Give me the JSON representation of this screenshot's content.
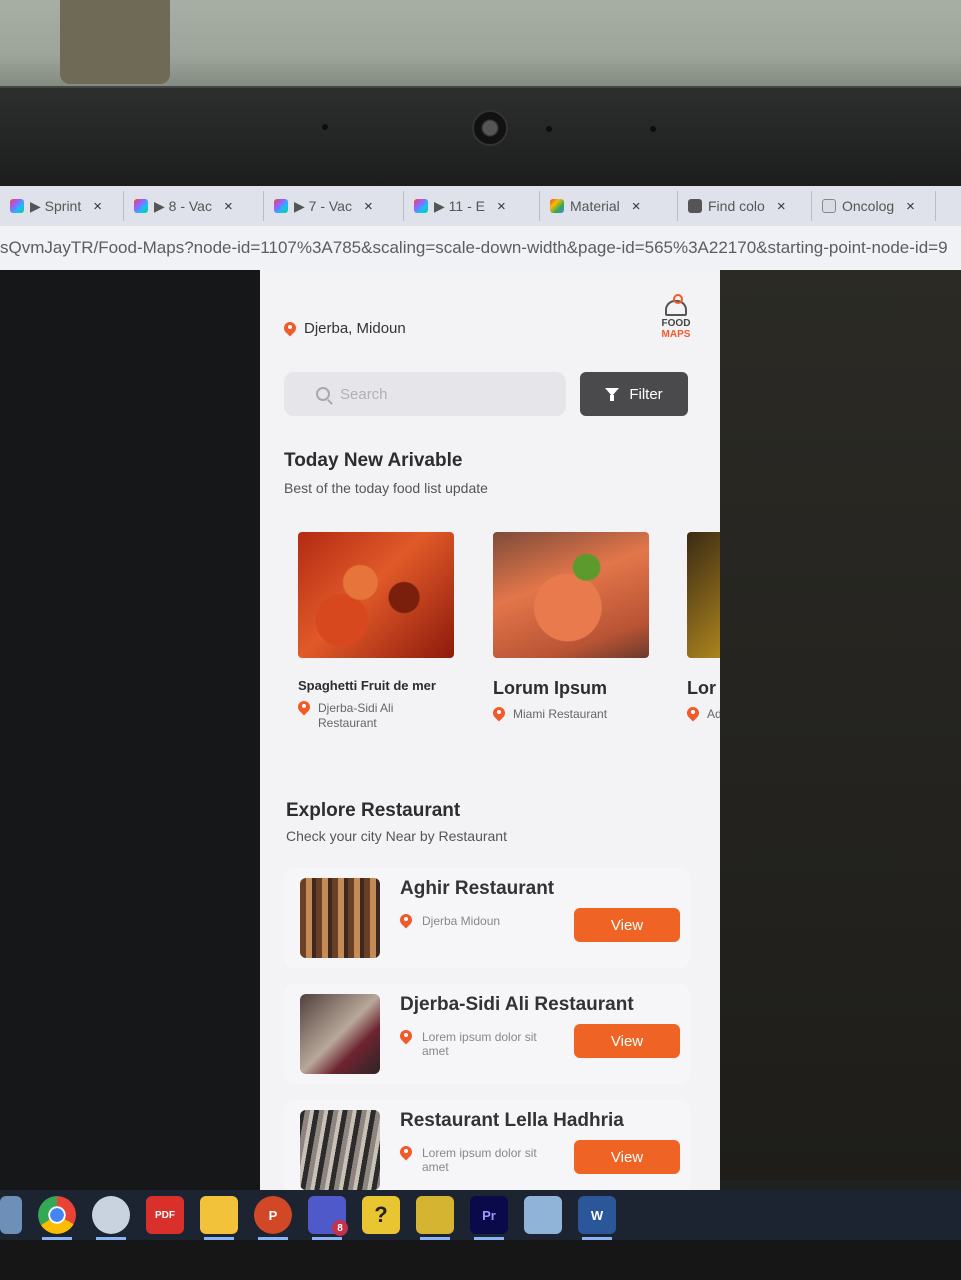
{
  "browser": {
    "tabs": [
      {
        "label": "▶ Sprint",
        "close": "×"
      },
      {
        "label": "▶ 8 - Vac",
        "close": "×"
      },
      {
        "label": "▶ 7 - Vac",
        "close": "×"
      },
      {
        "label": "▶ 11 - E",
        "close": "×"
      },
      {
        "label": "Material",
        "close": "×"
      },
      {
        "label": "Find colo",
        "close": "×"
      },
      {
        "label": "Oncolog",
        "close": "×"
      }
    ],
    "url": "sQvmJayTR/Food-Maps?node-id=1107%3A785&scaling=scale-down-width&page-id=565%3A22170&starting-point-node-id=9"
  },
  "app": {
    "location": "Djerba, Midoun",
    "logo_line1": "FOOD",
    "logo_line2": "MAPS",
    "search_placeholder": "Search",
    "filter_label": "Filter",
    "today": {
      "title": "Today New Arivable",
      "subtitle": "Best of the today food list update",
      "cards": [
        {
          "title": "Spaghetti Fruit de mer",
          "location": "Djerba-Sidi Ali Restaurant"
        },
        {
          "title": "Lorum Ipsum",
          "location": "Miami Restaurant"
        },
        {
          "title": "Lor",
          "location": "Ad"
        }
      ]
    },
    "explore": {
      "title": "Explore Restaurant",
      "subtitle": "Check your city Near by Restaurant",
      "restaurants": [
        {
          "name": "Aghir Restaurant",
          "address": "Djerba Midoun",
          "action": "View"
        },
        {
          "name": "Djerba-Sidi Ali Restaurant",
          "address": "Lorem ipsum dolor sit amet",
          "action": "View"
        },
        {
          "name": "Restaurant Lella Hadhria",
          "address": "Lorem ipsum dolor sit amet",
          "action": "View"
        }
      ]
    },
    "accent_color": "#ef6424",
    "filter_color": "#4a4a4c"
  },
  "taskbar": {
    "icons": [
      "calculator-icon",
      "chrome-icon",
      "snipping-tool-icon",
      "pdf-editor-icon",
      "file-explorer-icon",
      "powerpoint-icon",
      "teams-icon",
      "help-icon",
      "film-icon",
      "premiere-pro-icon",
      "notepad-icon",
      "word-icon"
    ],
    "teams_badge": "8",
    "pdf_label": "PDF",
    "ppt_label": "P",
    "help_label": "?",
    "pr_label": "Pr",
    "word_label": "W"
  }
}
